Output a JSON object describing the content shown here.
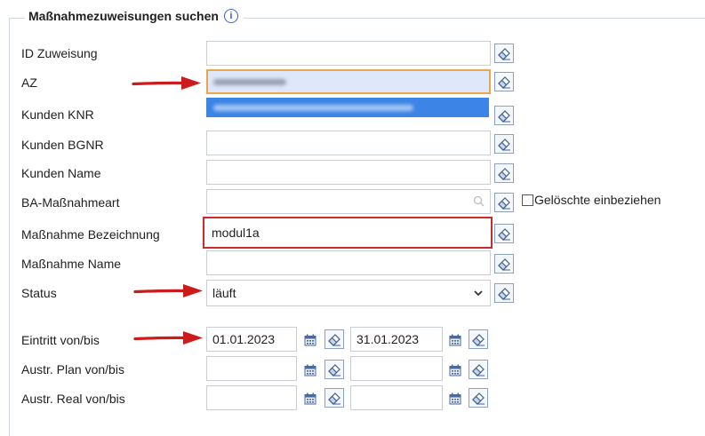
{
  "legend": {
    "title": "Maßnahmezuweisungen suchen",
    "info_icon": "ⓘ"
  },
  "fields": {
    "id_zuweisung": {
      "label": "ID Zuweisung",
      "value": ""
    },
    "az": {
      "label": "AZ",
      "value": ""
    },
    "kunden_knr": {
      "label": "Kunden KNR",
      "value": ""
    },
    "kunden_bgnr": {
      "label": "Kunden BGNR",
      "value": ""
    },
    "kunden_name": {
      "label": "Kunden Name",
      "value": ""
    },
    "ba_massnahmeart": {
      "label": "BA-Maßnahmeart",
      "value": "",
      "checkbox_label": "Gelöschte einbeziehen"
    },
    "massnahme_bezeichnung": {
      "label": "Maßnahme Bezeichnung",
      "value": "modul1a"
    },
    "massnahme_name": {
      "label": "Maßnahme Name",
      "value": ""
    },
    "status": {
      "label": "Status",
      "value": "läuft"
    },
    "eintritt": {
      "label": "Eintritt von/bis",
      "from": "01.01.2023",
      "to": "31.01.2023"
    },
    "austr_plan": {
      "label": "Austr. Plan von/bis",
      "from": "",
      "to": ""
    },
    "austr_real": {
      "label": "Austr. Real von/bis",
      "from": "",
      "to": ""
    }
  },
  "colors": {
    "arrow": "#cc1b1b",
    "az_focus_border": "#e8a552",
    "highlight_border": "#cc2b2b",
    "dropdown_selection": "#3c84e6"
  }
}
